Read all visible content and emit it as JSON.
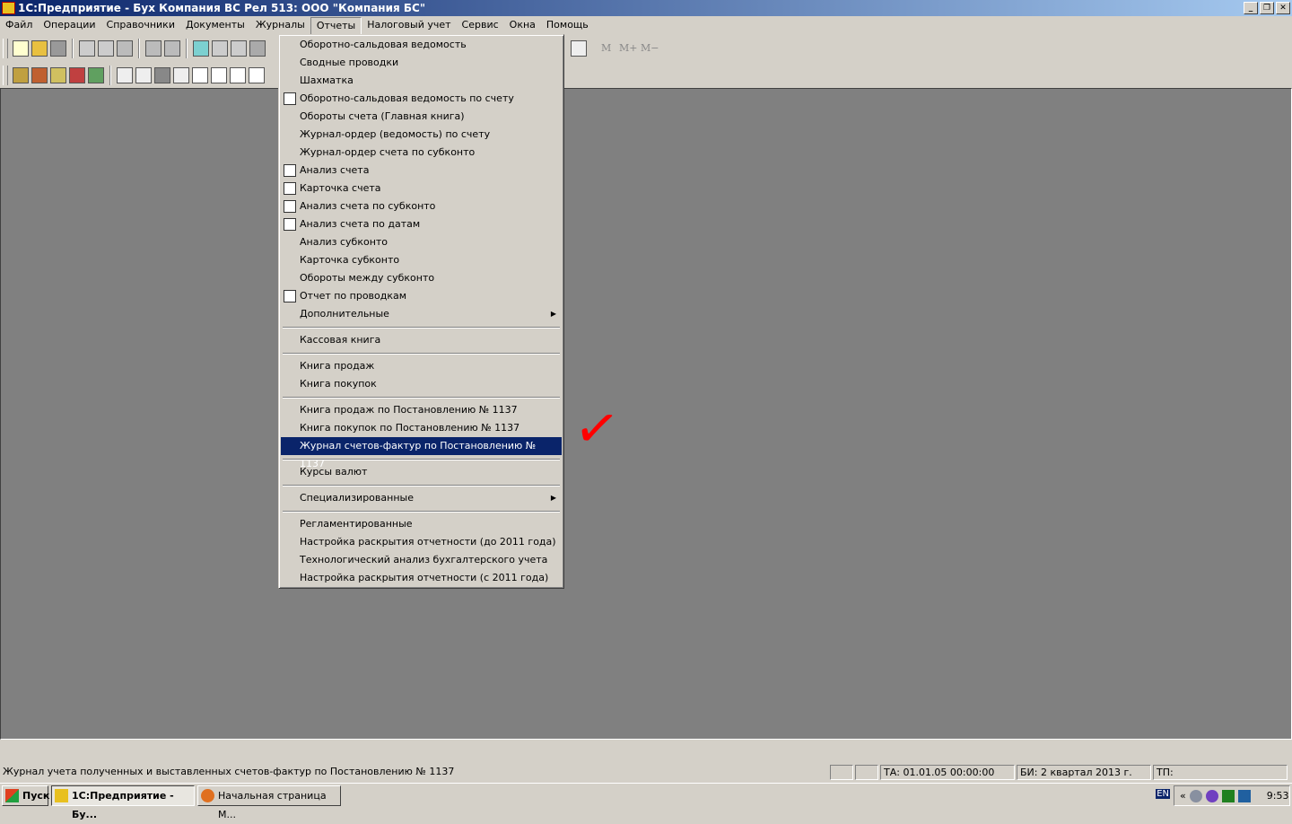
{
  "window": {
    "title": "1С:Предприятие - Бух Компания ВС Рел 513: ООО \"Компания БС\"",
    "min": "_",
    "max": "❐",
    "close": "✕"
  },
  "menubar": [
    "Файл",
    "Операции",
    "Справочники",
    "Документы",
    "Журналы",
    "Отчеты",
    "Налоговый учет",
    "Сервис",
    "Окна",
    "Помощь"
  ],
  "toolbar": {
    "m": "M",
    "mplus": "M+",
    "mminus": "M−"
  },
  "reports_menu": [
    {
      "label": "Оборотно-сальдовая ведомость"
    },
    {
      "label": "Сводные проводки"
    },
    {
      "label": "Шахматка"
    },
    {
      "label": "Оборотно-сальдовая ведомость по счету",
      "icon": "table-icon"
    },
    {
      "label": "Обороты счета (Главная книга)"
    },
    {
      "label": "Журнал-ордер (ведомость) по счету"
    },
    {
      "label": "Журнал-ордер счета по субконто"
    },
    {
      "label": "Анализ счета",
      "icon": "t-account-icon"
    },
    {
      "label": "Карточка счета",
      "icon": "t-card-icon"
    },
    {
      "label": "Анализ счета по субконто",
      "icon": "t-subconto-icon"
    },
    {
      "label": "Анализ счета по датам",
      "icon": "t-dates-icon"
    },
    {
      "label": "Анализ субконто"
    },
    {
      "label": "Карточка субконто"
    },
    {
      "label": "Обороты между субконто"
    },
    {
      "label": "Отчет по проводкам",
      "icon": "report-icon"
    },
    {
      "label": "Дополнительные",
      "submenu": true,
      "sep_after": true
    },
    {
      "label": "Кассовая книга",
      "sep_after": true
    },
    {
      "label": "Книга продаж"
    },
    {
      "label": "Книга покупок",
      "sep_after": true
    },
    {
      "label": "Книга продаж по Постановлению № 1137"
    },
    {
      "label": "Книга покупок по Постановлению № 1137"
    },
    {
      "label": "Журнал счетов-фактур по Постановлению № 1137",
      "selected": true,
      "sep_after": true
    },
    {
      "label": "Курсы валют",
      "sep_after": true
    },
    {
      "label": "Специализированные",
      "submenu": true,
      "sep_after": true
    },
    {
      "label": "Регламентированные"
    },
    {
      "label": "Настройка раскрытия отчетности (до 2011 года)"
    },
    {
      "label": "Технологический анализ бухгалтерского учета"
    },
    {
      "label": "Настройка раскрытия отчетности (с 2011 года)"
    }
  ],
  "status": {
    "message": "Журнал учета полученных и выставленных счетов-фактур по Постановлению № 1137",
    "ta": "ТА: 01.01.05  00:00:00",
    "bi": "БИ: 2 квартал 2013 г.",
    "tp": "ТП:"
  },
  "taskbar": {
    "start": "Пуск",
    "tasks": [
      "1С:Предприятие - Бу...",
      "Начальная страница M..."
    ],
    "lang": "EN",
    "chevron": "«",
    "clock": "9:53"
  }
}
